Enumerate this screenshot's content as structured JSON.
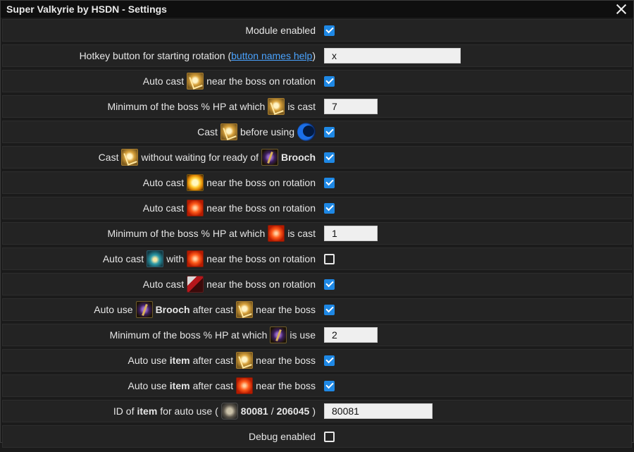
{
  "window": {
    "title": "Super Valkyrie by HSDN - Settings"
  },
  "rows": {
    "r1": {
      "label": "Module enabled",
      "checked": true
    },
    "r2": {
      "label_pre": "Hotkey button for starting rotation (",
      "link": "button names help",
      "label_post": ")",
      "value": "x"
    },
    "r3": {
      "a": "Auto cast",
      "b": "near the boss on rotation",
      "checked": true
    },
    "r4": {
      "a": "Minimum of the boss % HP at which",
      "b": "is cast",
      "value": "7"
    },
    "r5": {
      "a": "Cast",
      "b": "before using",
      "checked": true
    },
    "r6": {
      "a": "Cast",
      "b": "without waiting for ready of",
      "c": "Brooch",
      "checked": true
    },
    "r7": {
      "a": "Auto cast",
      "b": "near the boss on rotation",
      "checked": true
    },
    "r8": {
      "a": "Auto cast",
      "b": "near the boss on rotation",
      "checked": true
    },
    "r9": {
      "a": "Minimum of the boss % HP at which",
      "b": "is cast",
      "value": "1"
    },
    "r10": {
      "a": "Auto cast",
      "b": "with",
      "c": "near the boss on rotation",
      "checked": false
    },
    "r11": {
      "a": "Auto cast",
      "b": "near the boss on rotation",
      "checked": true
    },
    "r12": {
      "a": "Auto use",
      "b": "Brooch",
      "c": "after cast",
      "d": "near the boss",
      "checked": true
    },
    "r13": {
      "a": "Minimum of the boss % HP at which",
      "b": "is use",
      "value": "2"
    },
    "r14": {
      "a": "Auto use",
      "b": "item",
      "c": "after cast",
      "d": "near the boss",
      "checked": true
    },
    "r15": {
      "a": "Auto use",
      "b": "item",
      "c": "after cast",
      "d": "near the boss",
      "checked": true
    },
    "r16": {
      "a": "ID of",
      "b": "item",
      "c": "for auto use (",
      "d": "80081",
      "e": "/",
      "f": "206045",
      "g": ")",
      "value": "80081"
    },
    "r17": {
      "label": "Debug enabled",
      "checked": false
    }
  },
  "icons": {
    "skill_a": "gold-slash-skill-icon",
    "moon": "blue-crescent-icon",
    "brooch": "brooch-icon",
    "sun": "sun-orb-icon",
    "fire": "fire-orb-icon",
    "teal": "teal-skill-icon",
    "red": "red-blade-skill-icon",
    "item": "grey-item-icon"
  },
  "colors": {
    "accent": "#1e88e5",
    "link": "#4aa3ff",
    "row_bg": "#232323",
    "title_bg": "#0f0f0f"
  }
}
